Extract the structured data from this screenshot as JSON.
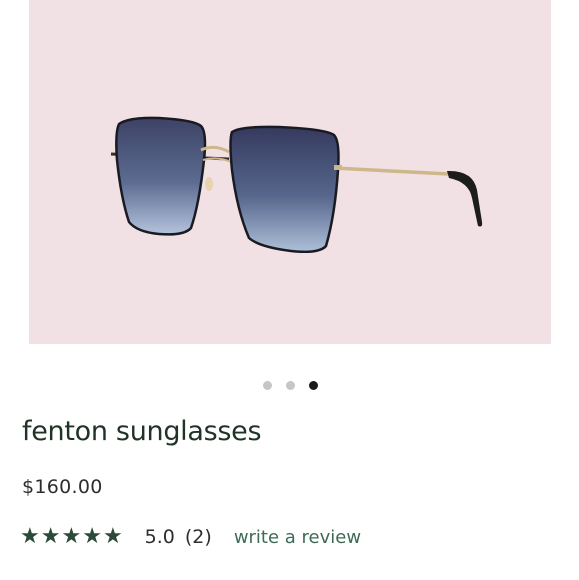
{
  "product": {
    "name": "fenton sunglasses",
    "price": "$160.00",
    "image": {
      "subject": "sunglasses-product-image",
      "background_color": "#f2e1e4"
    }
  },
  "carousel": {
    "total": 3,
    "active_index": 2
  },
  "rating": {
    "stars": 5,
    "value": "5.0",
    "count": "(2)",
    "star_color": "#2b4a39"
  },
  "review_link": {
    "label": "write a review",
    "color": "#3d6b55"
  }
}
